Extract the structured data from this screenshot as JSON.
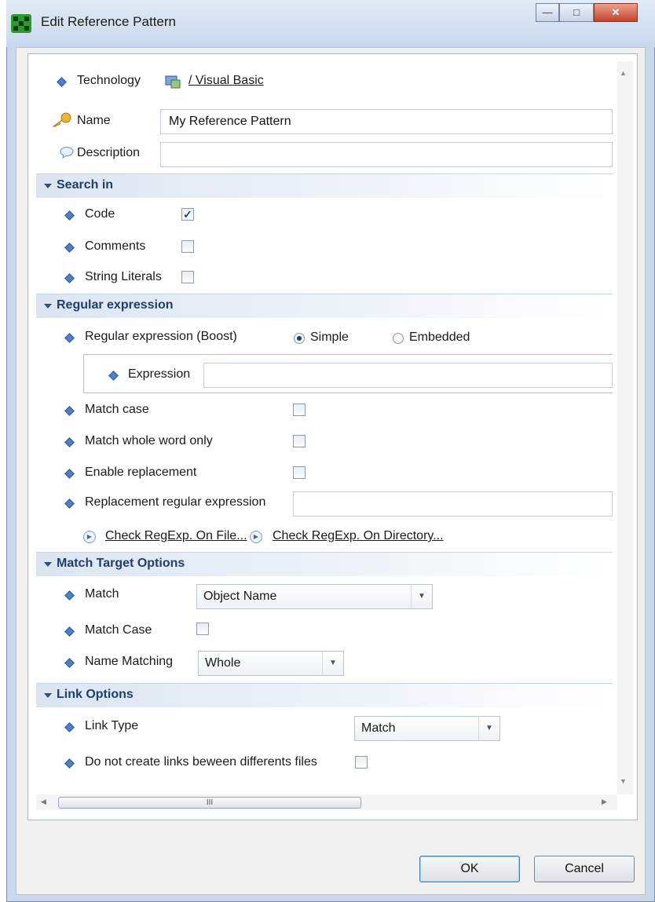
{
  "window": {
    "title": "Edit Reference Pattern"
  },
  "general": {
    "technology_label": "Technology",
    "technology_value": "/ Visual Basic",
    "name_label": "Name",
    "name_value": "My Reference Pattern",
    "description_label": "Description",
    "description_value": ""
  },
  "search_in": {
    "title": "Search in",
    "code_label": "Code",
    "code_checked": true,
    "comments_label": "Comments",
    "comments_checked": false,
    "string_literals_label": "String Literals",
    "string_literals_checked": false
  },
  "regex": {
    "title": "Regular expression",
    "regex_label": "Regular expression (Boost)",
    "mode_simple": "Simple",
    "mode_embedded": "Embedded",
    "selected_mode": "Simple",
    "expression_label": "Expression",
    "expression_value": "",
    "match_case_label": "Match case",
    "match_whole_word_label": "Match whole word only",
    "enable_replacement_label": "Enable replacement",
    "replacement_label": "Replacement regular expression",
    "replacement_value": "",
    "check_file_link": "Check RegExp. On File...",
    "check_dir_link": "Check RegExp. On Directory..."
  },
  "match_target": {
    "title": "Match Target Options",
    "match_label": "Match",
    "match_value": "Object Name",
    "match_case_label": "Match Case",
    "name_matching_label": "Name Matching",
    "name_matching_value": "Whole"
  },
  "link_options": {
    "title": "Link Options",
    "link_type_label": "Link Type",
    "link_type_value": "Match",
    "no_links_label": "Do not create links beween differents files"
  },
  "scrollbar": {
    "thumb_grip": "III"
  },
  "buttons": {
    "ok": "OK",
    "cancel": "Cancel"
  },
  "colors": {
    "accent": "#1f3f6a",
    "section_bg": "#dbe5f1",
    "bullet": "#4f7fc1"
  },
  "icons": {
    "title": "app-grid-icon",
    "technology": "technology-icon",
    "name": "key-icon",
    "description": "speech-bubble-icon",
    "bullet": "diamond-icon"
  }
}
